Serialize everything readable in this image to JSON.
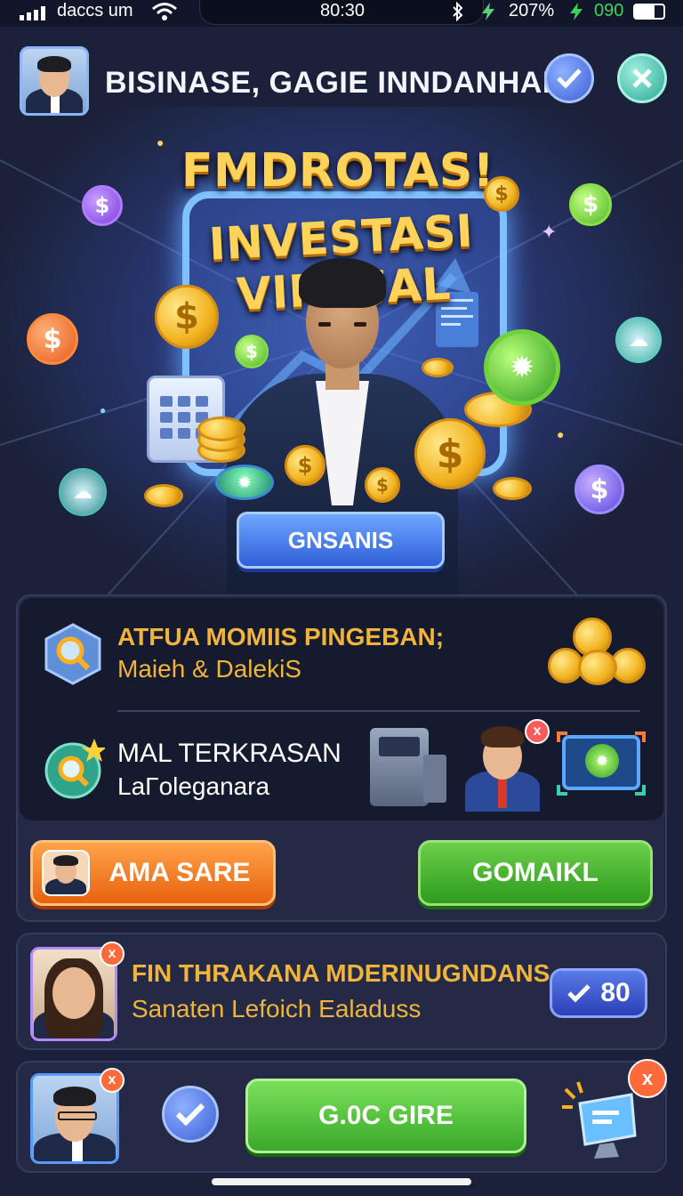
{
  "status_bar": {
    "carrier": "daccs um",
    "time": "80:30",
    "battery_percent": "207%",
    "battery_level": "090"
  },
  "header": {
    "title": "BISINASE, GAGIE INNDANHAN"
  },
  "hero": {
    "title_line1": "FMDROTAS!",
    "title_line2": "INVESTASI VIRTUAL",
    "button_label": "GNSANIS",
    "dollar_glyph": "$"
  },
  "info_card": {
    "row1": {
      "title": "ATFUA MOMIIS PINGEBAN;",
      "subtitle": "Maieh & DalekiS"
    },
    "row2": {
      "title": "MAL TERKRASAN",
      "subtitle": "LaΓoleganara"
    },
    "left_button": "AMA SARE",
    "right_button": "GOMAIKL"
  },
  "notice_card": {
    "title": "FIN THRAKANA MDERINUGNDANS",
    "subtitle": "Sanaten Lefoich Ealaduss",
    "count": "80",
    "badge_mark": "x"
  },
  "bottom_card": {
    "button_label": "G.0C GIRE",
    "badge_mark": "x"
  },
  "colors": {
    "background": "#1b2138",
    "gold": "#f0b43c",
    "green": "#4cae3a",
    "orange": "#f07a1e",
    "blue": "#3b5fd8"
  }
}
